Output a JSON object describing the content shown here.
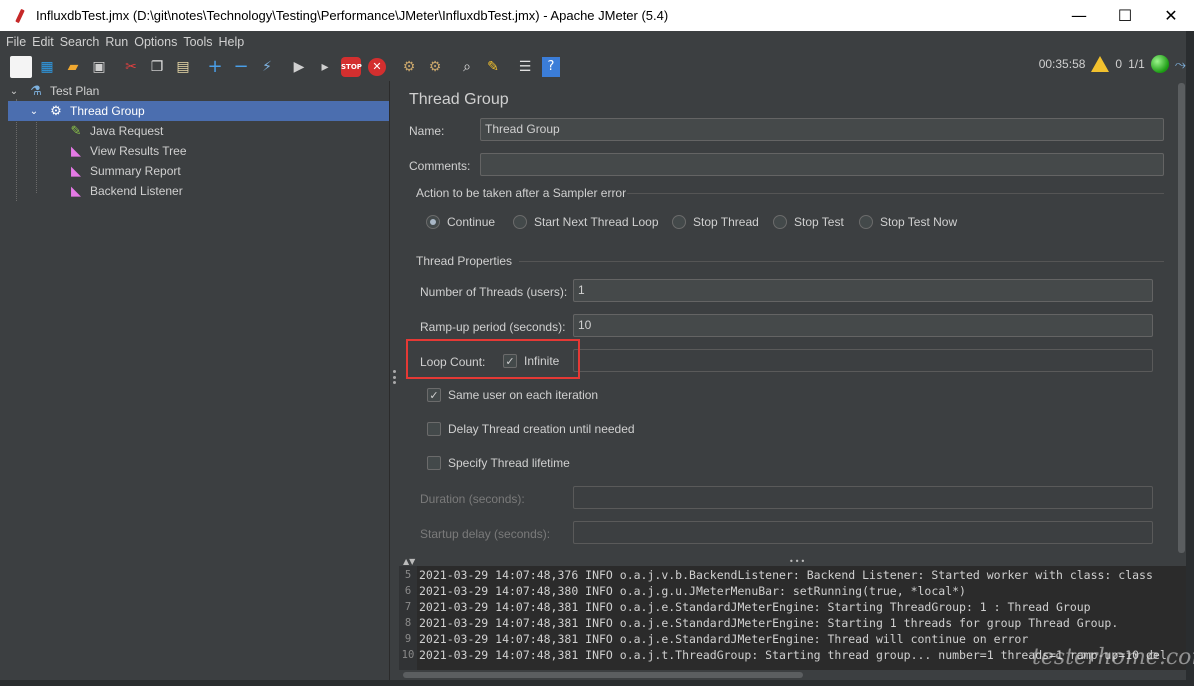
{
  "window": {
    "title": "InfluxdbTest.jmx (D:\\git\\notes\\Technology\\Testing\\Performance\\JMeter\\InfluxdbTest.jmx) - Apache JMeter (5.4)",
    "minimize": "—",
    "maximize": "☐",
    "close": "✕"
  },
  "menu": [
    "File",
    "Edit",
    "Search",
    "Run",
    "Options",
    "Tools",
    "Help"
  ],
  "status": {
    "elapsed": "00:35:58",
    "warnings": "0",
    "threads": "1/1"
  },
  "tree": {
    "root": "Test Plan",
    "thread_group": "Thread Group",
    "children": [
      "Java Request",
      "View Results Tree",
      "Summary Report",
      "Backend Listener"
    ]
  },
  "panel": {
    "title": "Thread Group",
    "name_label": "Name:",
    "name_value": "Thread Group",
    "comments_label": "Comments:",
    "comments_value": "",
    "error_action_title": "Action to be taken after a Sampler error",
    "error_actions": [
      "Continue",
      "Start Next Thread Loop",
      "Stop Thread",
      "Stop Test",
      "Stop Test Now"
    ],
    "selected_error_action": "Continue",
    "thread_props_title": "Thread Properties",
    "threads_label": "Number of Threads (users):",
    "threads_value": "1",
    "rampup_label": "Ramp-up period (seconds):",
    "rampup_value": "10",
    "loop_label": "Loop Count:",
    "infinite_label": "Infinite",
    "infinite_checked": true,
    "loop_value": "",
    "same_user_label": "Same user on each iteration",
    "same_user_checked": true,
    "delay_label": "Delay Thread creation until needed",
    "delay_checked": false,
    "lifetime_label": "Specify Thread lifetime",
    "lifetime_checked": false,
    "duration_label": "Duration (seconds):",
    "duration_value": "",
    "startup_label": "Startup delay (seconds):",
    "startup_value": ""
  },
  "log": [
    {
      "n": "5",
      "text": "2021-03-29 14:07:48,376 INFO o.a.j.v.b.BackendListener: Backend Listener: Started  worker with class: class"
    },
    {
      "n": "6",
      "text": "2021-03-29 14:07:48,380 INFO o.a.j.g.u.JMeterMenuBar: setRunning(true, *local*)"
    },
    {
      "n": "7",
      "text": "2021-03-29 14:07:48,381 INFO o.a.j.e.StandardJMeterEngine: Starting ThreadGroup: 1 : Thread Group"
    },
    {
      "n": "8",
      "text": "2021-03-29 14:07:48,381 INFO o.a.j.e.StandardJMeterEngine: Starting 1 threads for group Thread Group."
    },
    {
      "n": "9",
      "text": "2021-03-29 14:07:48,381 INFO o.a.j.e.StandardJMeterEngine: Thread will continue on error"
    },
    {
      "n": "10",
      "text": "2021-03-29 14:07:48,381 INFO o.a.j.t.ThreadGroup: Starting thread group... number=1 threads=1 ramp-up=10 del"
    }
  ],
  "watermark": "testerhome.com"
}
